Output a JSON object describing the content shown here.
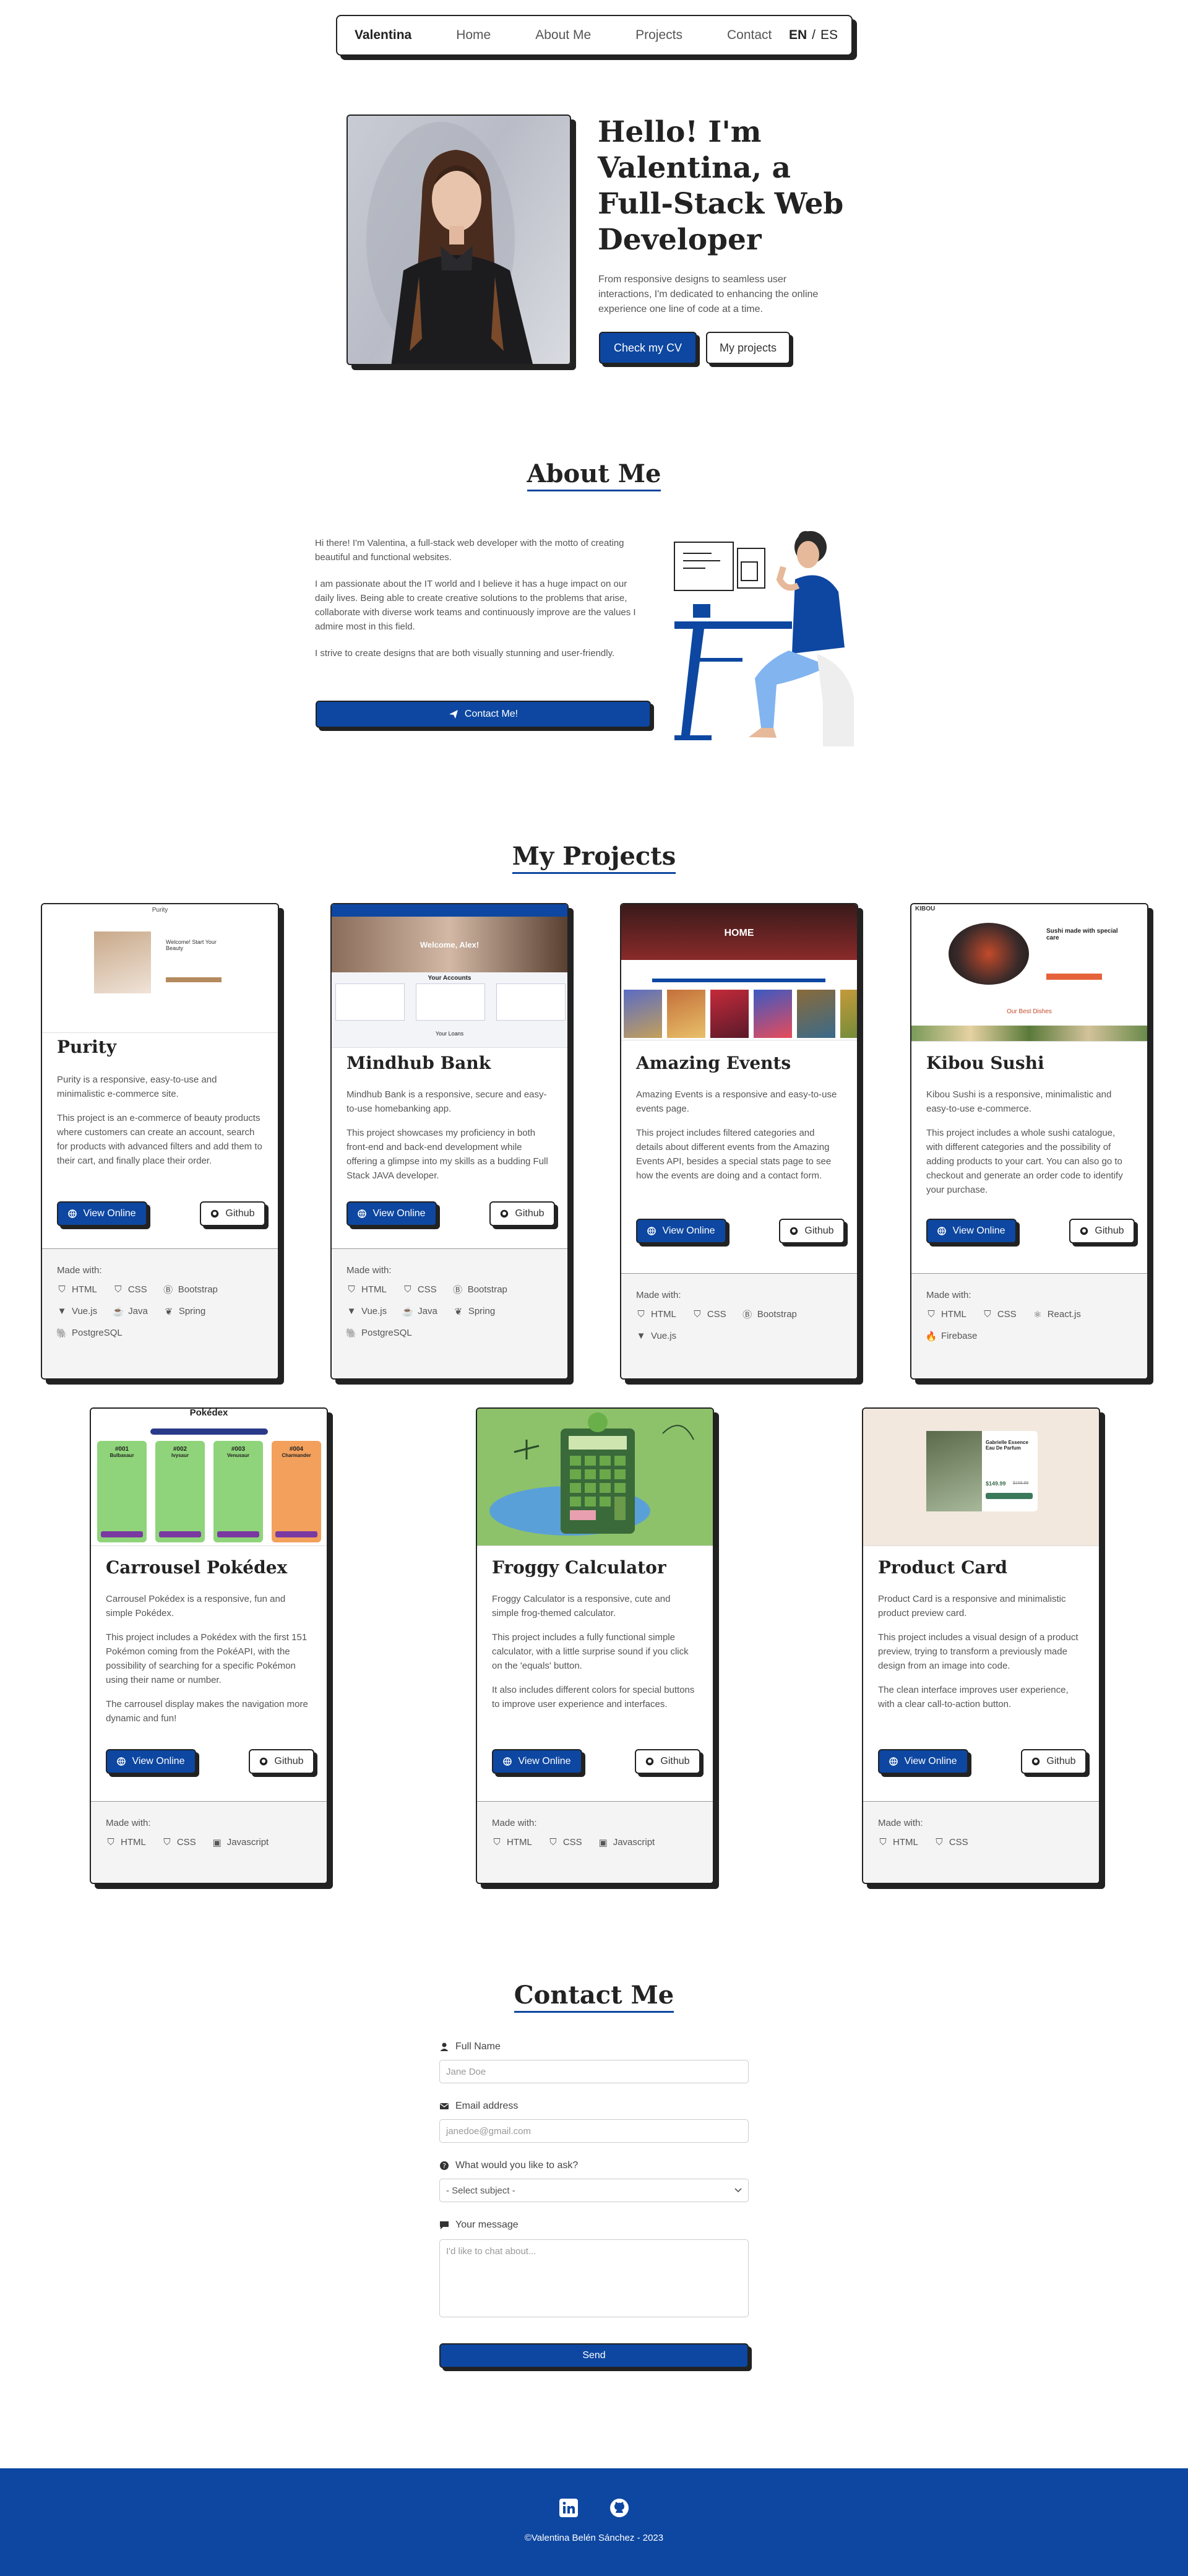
{
  "nav": {
    "brand": "Valentina",
    "links": [
      "Home",
      "About Me",
      "Projects",
      "Contact"
    ],
    "lang_en": "EN",
    "lang_sep": "/",
    "lang_es": "ES"
  },
  "hero": {
    "title": "Hello! I'm Valentina, a Full-Stack Web Developer",
    "text": "From responsive designs to seamless user interactions, I'm dedicated to enhancing the online experience one line of code at a time.",
    "cv_button": "Check my CV",
    "projects_button": "My projects"
  },
  "about": {
    "title": "About Me",
    "paragraphs": [
      "Hi there! I'm Valentina, a full-stack web developer with the motto of creating beautiful and functional websites.",
      "I am passionate about the IT world and I believe it has a huge impact on our daily lives. Being able to create creative solutions to the problems that arise, collaborate with diverse work teams and continuously improve are the values I admire most in this field.",
      "I strive to create designs that are both visually stunning and user-friendly."
    ],
    "contact_button": "Contact Me!"
  },
  "projects": {
    "title": "My Projects",
    "made_with": "Made with:",
    "view_label": "View Online",
    "github_label": "Github",
    "items": [
      {
        "title": "Purity",
        "desc": [
          "Purity is a responsive, easy-to-use and minimalistic e-commerce site.",
          "This project is an e-commerce of beauty products where customers can create an account, search for products with advanced filters and add them to their cart, and finally place their order."
        ],
        "tech": [
          "HTML",
          "CSS",
          "Bootstrap",
          "Vue.js",
          "Java",
          "Spring",
          "PostgreSQL"
        ],
        "preview": {
          "logo": "Purity",
          "heading": "Welcome! Start Your Beauty"
        }
      },
      {
        "title": "Mindhub Bank",
        "desc": [
          "Mindhub Bank is a responsive, secure and easy-to-use homebanking app.",
          "This project showcases my proficiency in both front-end and back-end development while offering a glimpse into my skills as a budding Full Stack JAVA developer."
        ],
        "tech": [
          "HTML",
          "CSS",
          "Bootstrap",
          "Vue.js",
          "Java",
          "Spring",
          "PostgreSQL"
        ],
        "preview": {
          "welcome": "Welcome, Alex!",
          "accounts": "Your Accounts",
          "loans": "Your Loans"
        }
      },
      {
        "title": "Amazing Events",
        "desc": [
          "Amazing Events is a responsive and easy-to-use events page.",
          "This project includes filtered categories and details about different events from the Amazing Events API, besides a special stats page to see how the events are doing and a contact form."
        ],
        "tech": [
          "HTML",
          "CSS",
          "Bootstrap",
          "Vue.js"
        ],
        "preview": {
          "heading": "HOME"
        }
      },
      {
        "title": "Kibou Sushi",
        "desc": [
          "Kibou Sushi is a responsive, minimalistic and easy-to-use e-commerce.",
          "This project includes a whole sushi catalogue, with different categories and the possibility of adding products to your cart. You can also go to checkout and generate an order code to identify your purchase."
        ],
        "tech": [
          "HTML",
          "CSS",
          "React.js",
          "Firebase"
        ],
        "preview": {
          "logo": "KIBOU",
          "heading": "Sushi made with special care",
          "sub": "Our Best Dishes"
        }
      },
      {
        "title": "Carrousel Pokédex",
        "desc": [
          "Carrousel Pokédex is a responsive, fun and simple Pokédex.",
          "This project includes a Pokédex with the first 151 Pokémon coming from the PokéAPI, with the possibility of searching for a specific Pokémon using their name or number.",
          "The carrousel display makes the navigation more dynamic and fun!"
        ],
        "tech": [
          "HTML",
          "CSS",
          "Javascript"
        ],
        "preview": {
          "heading": "Pokédex",
          "cards": [
            {
              "num": "#001",
              "name": "Bulbasaur",
              "color": "#8fd47a"
            },
            {
              "num": "#002",
              "name": "Ivysaur",
              "color": "#8fd47a"
            },
            {
              "num": "#003",
              "name": "Venusaur",
              "color": "#8fd47a"
            },
            {
              "num": "#004",
              "name": "Charmander",
              "color": "#f2a05c"
            }
          ]
        }
      },
      {
        "title": "Froggy Calculator",
        "desc": [
          "Froggy Calculator is a responsive, cute and simple frog-themed calculator.",
          "This project includes a fully functional simple calculator, with a little surprise sound if you click on the 'equals' button.",
          "It also includes different colors for special buttons to improve user experience and interfaces."
        ],
        "tech": [
          "HTML",
          "CSS",
          "Javascript"
        ]
      },
      {
        "title": "Product Card",
        "desc": [
          "Product Card is a responsive and minimalistic product preview card.",
          "This project includes a visual design of a product preview, trying to transform a previously made design from an image into code.",
          "The clean interface improves user experience, with a clear call-to-action button."
        ],
        "tech": [
          "HTML",
          "CSS"
        ],
        "preview": {
          "name": "Gabrielle Essence Eau De Parfum",
          "price": "$149.99",
          "old_price": "$169.99"
        }
      }
    ]
  },
  "contact": {
    "title": "Contact Me",
    "name_label": "Full Name",
    "name_placeholder": "Jane Doe",
    "email_label": "Email address",
    "email_placeholder": "janedoe@gmail.com",
    "subject_label": "What would you like to ask?",
    "subject_value": "- Select subject -",
    "message_label": "Your message",
    "message_placeholder": "I'd like to chat about...",
    "send_button": "Send"
  },
  "footer": {
    "copyright": "©Valentina Belén Sánchez - 2023"
  },
  "colors": {
    "primary": "#0d47a1",
    "dark": "#222222"
  }
}
